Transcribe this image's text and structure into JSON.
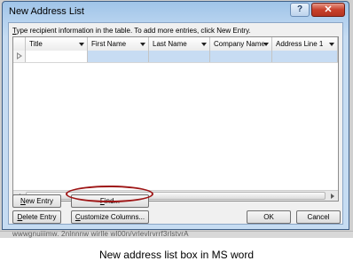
{
  "dialog": {
    "title": "New Address List",
    "help_label": "?",
    "close_label": "✕",
    "instruction": "Type recipient information in the table.  To add more entries, click New Entry."
  },
  "columns": [
    "Title",
    "First Name",
    "Last Name",
    "Company Name",
    "Address Line 1"
  ],
  "buttons": {
    "new_entry": {
      "access": "N",
      "rest": "ew Entry"
    },
    "delete_entry": {
      "access": "D",
      "rest": "elete Entry"
    },
    "find": {
      "access": "F",
      "rest": "ind..."
    },
    "customize_columns": {
      "access": "C",
      "rest": "ustomize Columns..."
    },
    "ok": "OK",
    "cancel": "Cancel"
  },
  "background_text": "wwwgnuiiimw. 2nlnnnw wirlle wl00n/vrlevlrvrrf3rlstvrA",
  "caption": "New address list box in MS word"
}
